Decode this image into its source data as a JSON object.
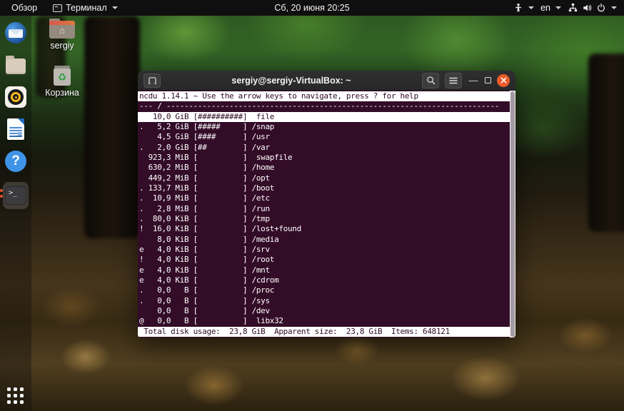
{
  "colors": {
    "accent_orange": "#EC5B29",
    "terminal_bg": "#330C27",
    "terminal_fg": "#FFFFFF",
    "reverse_bg": "#FFFFFF",
    "reverse_fg": "#2D0A23"
  },
  "top_bar": {
    "activities_label": "Обзор",
    "app_menu_label": "Терминал",
    "clock": "Сб, 20 июня  20:25",
    "keyboard_layout": "en",
    "icons": [
      "accessibility-icon",
      "network-wired-icon",
      "volume-icon",
      "power-icon"
    ]
  },
  "dock": {
    "items": [
      "thunderbird",
      "files",
      "rhythmbox",
      "libreoffice-writer",
      "help",
      "terminal",
      "show-applications"
    ],
    "terminal_prompt_glyph": ">_"
  },
  "desktop": {
    "icons": [
      {
        "label": "sergiy",
        "type": "home-folder"
      },
      {
        "label": "Корзина",
        "type": "trash"
      }
    ]
  },
  "window": {
    "title": "sergiy@sergiy-VirtualBox: ~",
    "titlebar_icons": [
      "new-tab-icon",
      "search-icon",
      "menu-icon",
      "minimize-icon",
      "maximize-icon",
      "close-icon"
    ],
    "terminal": {
      "rows": [
        {
          "kind": "header",
          "reverse": true,
          "text": "ncdu 1.14.1 ~ Use the arrow keys to navigate, press ? for help"
        },
        {
          "kind": "path",
          "reverse": false,
          "text": "--- / --------------------------------------------------------------------------"
        },
        {
          "kind": "entry",
          "reverse": true,
          "text": "   10,0 GiB [##########]  file"
        },
        {
          "kind": "entry",
          "reverse": false,
          "text": ".   5,2 GiB [#####     ] /snap"
        },
        {
          "kind": "entry",
          "reverse": false,
          "text": "    4,5 GiB [####      ] /usr"
        },
        {
          "kind": "entry",
          "reverse": false,
          "text": ".   2,0 GiB [##        ] /var"
        },
        {
          "kind": "entry",
          "reverse": false,
          "text": "  923,3 MiB [          ]  swapfile"
        },
        {
          "kind": "entry",
          "reverse": false,
          "text": "  630,2 MiB [          ] /home"
        },
        {
          "kind": "entry",
          "reverse": false,
          "text": "  449,2 MiB [          ] /opt"
        },
        {
          "kind": "entry",
          "reverse": false,
          "text": ". 133,7 MiB [          ] /boot"
        },
        {
          "kind": "entry",
          "reverse": false,
          "text": ".  10,9 MiB [          ] /etc"
        },
        {
          "kind": "entry",
          "reverse": false,
          "text": ".   2,8 MiB [          ] /run"
        },
        {
          "kind": "entry",
          "reverse": false,
          "text": ".  80,0 KiB [          ] /tmp"
        },
        {
          "kind": "entry",
          "reverse": false,
          "text": "!  16,0 KiB [          ] /lost+found"
        },
        {
          "kind": "entry",
          "reverse": false,
          "text": "    8,0 KiB [          ] /media"
        },
        {
          "kind": "entry",
          "reverse": false,
          "text": "e   4,0 KiB [          ] /srv"
        },
        {
          "kind": "entry",
          "reverse": false,
          "text": "!   4,0 KiB [          ] /root"
        },
        {
          "kind": "entry",
          "reverse": false,
          "text": "e   4,0 KiB [          ] /mnt"
        },
        {
          "kind": "entry",
          "reverse": false,
          "text": "e   4,0 KiB [          ] /cdrom"
        },
        {
          "kind": "entry",
          "reverse": false,
          "text": ".   0,0   B [          ] /proc"
        },
        {
          "kind": "entry",
          "reverse": false,
          "text": ".   0,0   B [          ] /sys"
        },
        {
          "kind": "entry",
          "reverse": false,
          "text": "    0,0   B [          ] /dev"
        },
        {
          "kind": "entry",
          "reverse": false,
          "text": "@   0,0   B [          ]  libx32"
        },
        {
          "kind": "footer",
          "reverse": true,
          "text": " Total disk usage:  23,8 GiB  Apparent size:  23,8 GiB  Items: 648121"
        }
      ]
    }
  }
}
